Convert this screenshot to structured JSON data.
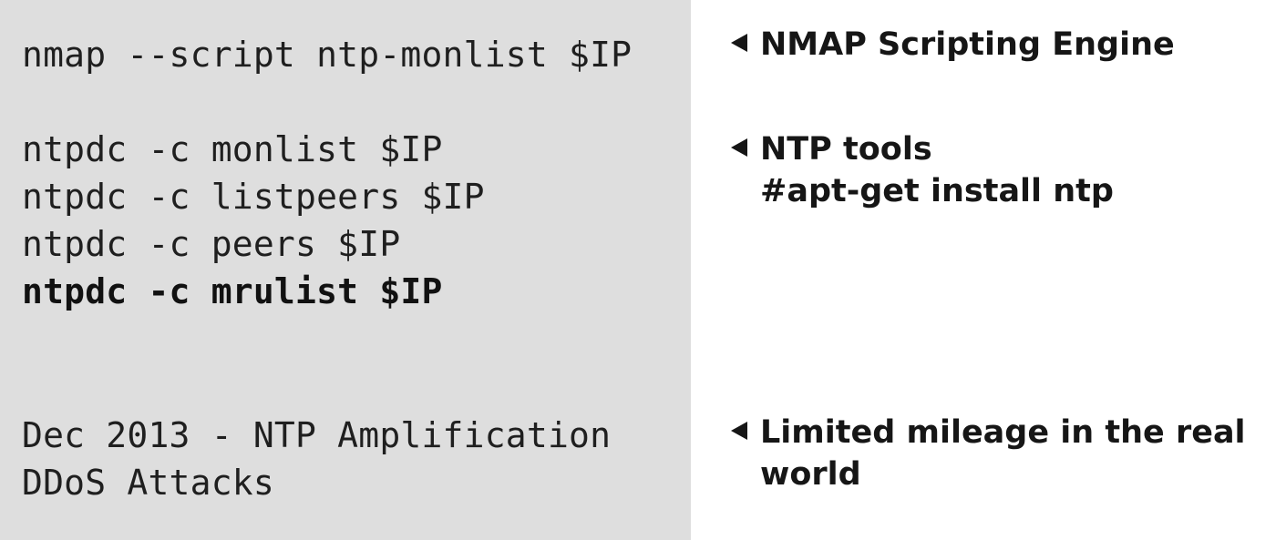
{
  "code": {
    "nmap": "nmap --script ntp-monlist $IP",
    "ntpdc_monlist": "ntpdc -c monlist $IP",
    "ntpdc_listpeers": "ntpdc -c listpeers $IP",
    "ntpdc_peers": "ntpdc -c peers $IP",
    "ntpdc_mrulist": "ntpdc -c mrulist $IP",
    "history_line1": "Dec 2013 - NTP Amplification",
    "history_line2": "DDoS Attacks"
  },
  "notes": {
    "nse": "NMAP Scripting Engine",
    "ntp_tools": "NTP tools",
    "ntp_install": "#apt-get install ntp",
    "mileage_line1": "Limited mileage in the real",
    "mileage_line2": "world"
  },
  "colors": {
    "code_panel_bg": "#dedede",
    "text": "#1f1f1f"
  },
  "icons": {
    "bullet": "left-pointing-triangle-icon"
  }
}
